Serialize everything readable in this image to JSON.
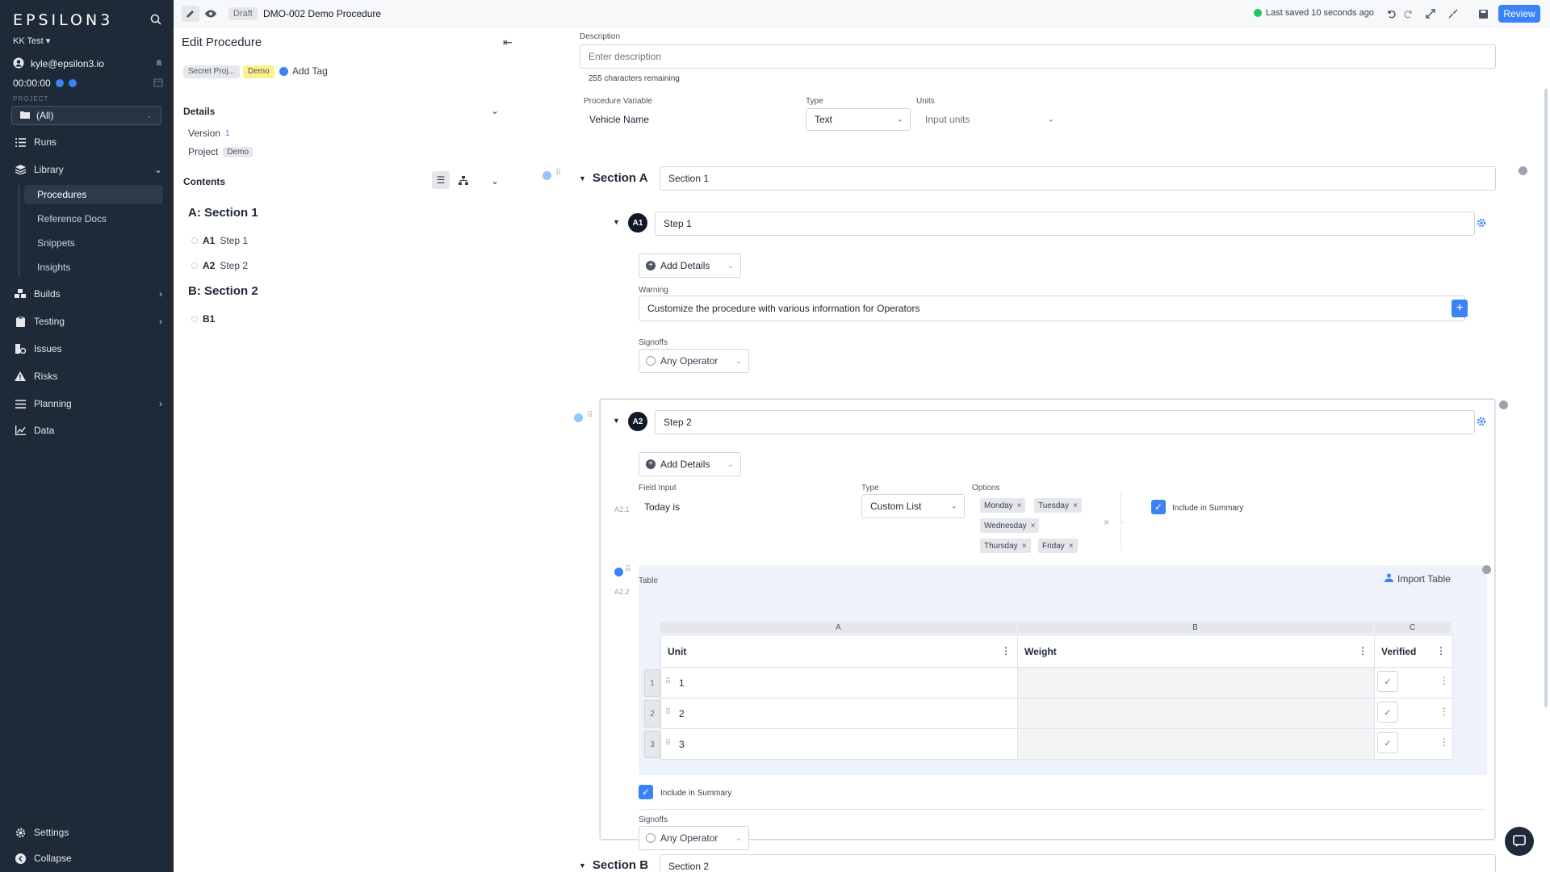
{
  "sidebar": {
    "logo": "EPSILON3",
    "workspace": "KK Test ▾",
    "user_email": "kyle@epsilon3.io",
    "timer": "00:00:00",
    "projects_label": "PROJECT",
    "project_select": "(All)",
    "nav": {
      "runs": "Runs",
      "library": "Library",
      "procedures": "Procedures",
      "reference_docs": "Reference Docs",
      "snippets": "Snippets",
      "insights": "Insights",
      "builds": "Builds",
      "testing": "Testing",
      "issues": "Issues",
      "risks": "Risks",
      "planning": "Planning",
      "data": "Data",
      "settings": "Settings",
      "collapse": "Collapse"
    }
  },
  "topbar": {
    "draft": "Draft",
    "title": "DMO-002 Demo Procedure",
    "saved": "Last saved 10 seconds ago",
    "review": "Review"
  },
  "left_panel": {
    "title": "Edit Procedure",
    "tags": [
      "Secret Proj...",
      "Demo"
    ],
    "add_tag": "Add Tag",
    "details_heading": "Details",
    "version_label": "Version",
    "version_value": "1",
    "project_label": "Project",
    "project_value": "Demo",
    "contents_heading": "Contents",
    "sections": [
      {
        "title": "A: Section 1",
        "steps": [
          {
            "id": "A1",
            "name": "Step 1"
          },
          {
            "id": "A2",
            "name": "Step 2"
          }
        ]
      },
      {
        "title": "B: Section 2",
        "steps": [
          {
            "id": "B1",
            "name": ""
          }
        ]
      }
    ]
  },
  "main": {
    "description_label": "Description",
    "description_placeholder": "Enter description",
    "chars_remaining": "255 characters remaining",
    "var_label": "Procedure Variable",
    "var_value": "Vehicle Name",
    "type_label": "Type",
    "type_value": "Text",
    "units_label": "Units",
    "units_placeholder": "Input units",
    "section_a_label": "Section A",
    "section_a_name": "Section 1",
    "step1": {
      "badge": "A1",
      "name": "Step 1",
      "add_details": "Add Details",
      "warning_label": "Warning",
      "warning_text": "Customize the procedure with various information for Operators",
      "signoffs_label": "Signoffs",
      "signoff_value": "Any Operator"
    },
    "step2": {
      "badge": "A2",
      "name": "Step 2",
      "add_details": "Add Details",
      "field_input_label": "Field Input",
      "field_id": "A2.1",
      "field_value": "Today is",
      "type_label": "Type",
      "type_value": "Custom List",
      "options_label": "Options",
      "options": [
        "Monday",
        "Tuesday",
        "Wednesday",
        "Thursday",
        "Friday"
      ],
      "include_summary": "Include in Summary",
      "table_label": "Table",
      "table_id": "A2.2",
      "import_table": "Import Table",
      "col_letters": [
        "A",
        "B",
        "C"
      ],
      "columns": [
        "Unit",
        "Weight",
        "Verified"
      ],
      "rows": [
        {
          "num": "1",
          "unit": "1"
        },
        {
          "num": "2",
          "unit": "2"
        },
        {
          "num": "3",
          "unit": "3"
        }
      ],
      "table_include_summary": "Include in Summary",
      "signoffs_label": "Signoffs",
      "signoff_value": "Any Operator"
    },
    "section_b_label": "Section B",
    "section_b_name": "Section 2"
  },
  "colors": {
    "sidebar": "#1e2a38",
    "accent": "#3b82f6",
    "saved": "#22c55e",
    "demo_tag": "#fef08a"
  }
}
